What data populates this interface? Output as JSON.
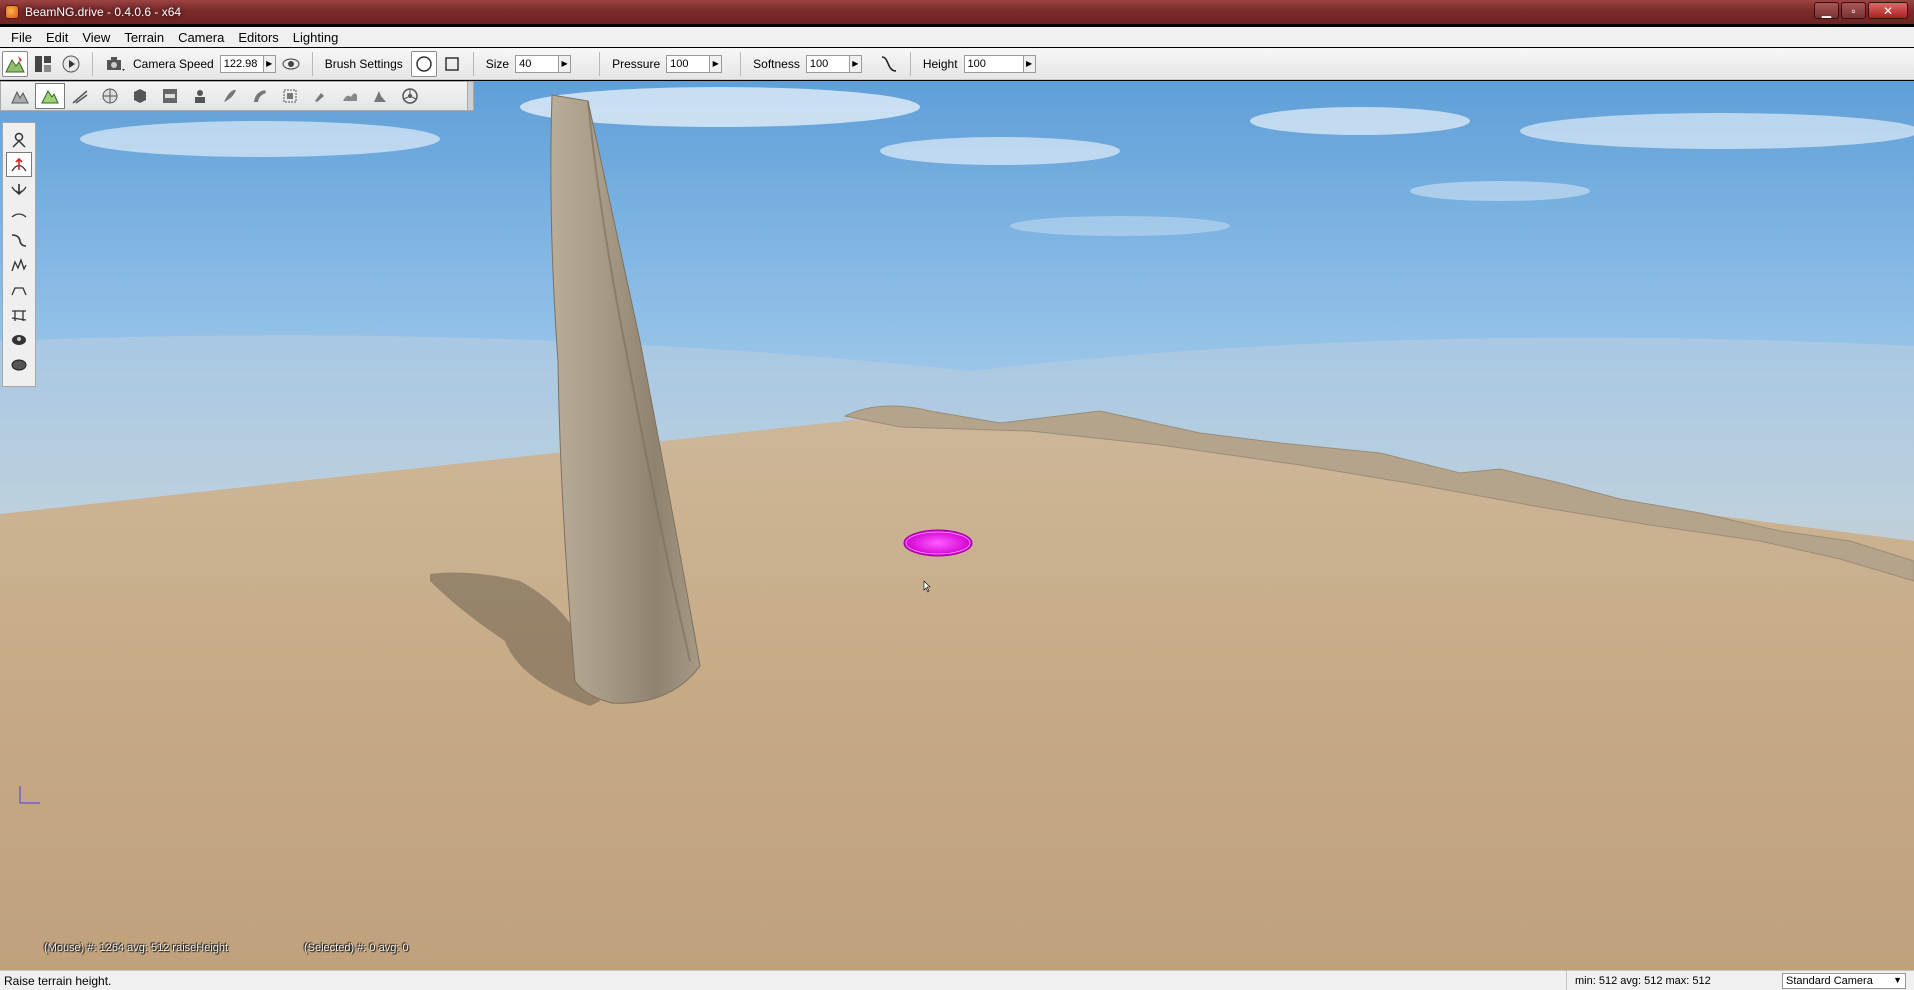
{
  "window": {
    "title": "BeamNG.drive - 0.4.0.6 - x64",
    "minimize": "▁",
    "maximize": "▫",
    "close": "✕"
  },
  "menu": [
    "File",
    "Edit",
    "View",
    "Terrain",
    "Camera",
    "Editors",
    "Lighting"
  ],
  "toolbar": {
    "camera_speed_label": "Camera Speed",
    "camera_speed_value": "122.98",
    "brush_settings_label": "Brush Settings",
    "size_label": "Size",
    "size_value": "40",
    "pressure_label": "Pressure",
    "pressure_value": "100",
    "softness_label": "Softness",
    "softness_value": "100",
    "height_label": "Height",
    "height_value": "100"
  },
  "terrain_tools": [
    "terrain-editor-icon",
    "paint-terrain-icon",
    "road-icon",
    "globe-icon",
    "cube-icon",
    "datablock-icon",
    "decal-icon",
    "forest-icon",
    "river-icon",
    "mesh-road-icon",
    "select-icon",
    "paint-icon",
    "shore-icon",
    "deform-icon"
  ],
  "overlay": {
    "mouse_info": "(Mouse) #: 1264  avg: 512 raiseHeight",
    "selected_info": "(Selected) #: 0  avg: 0"
  },
  "status": {
    "message": "Raise terrain height.",
    "stats": "min: 512  avg: 512  max: 512",
    "camera_mode": "Standard Camera"
  },
  "colors": {
    "title_bar": "#7a2a2a",
    "brush": "#e020e0",
    "sky": "#8cbde6",
    "terrain": "#c6ad87"
  }
}
